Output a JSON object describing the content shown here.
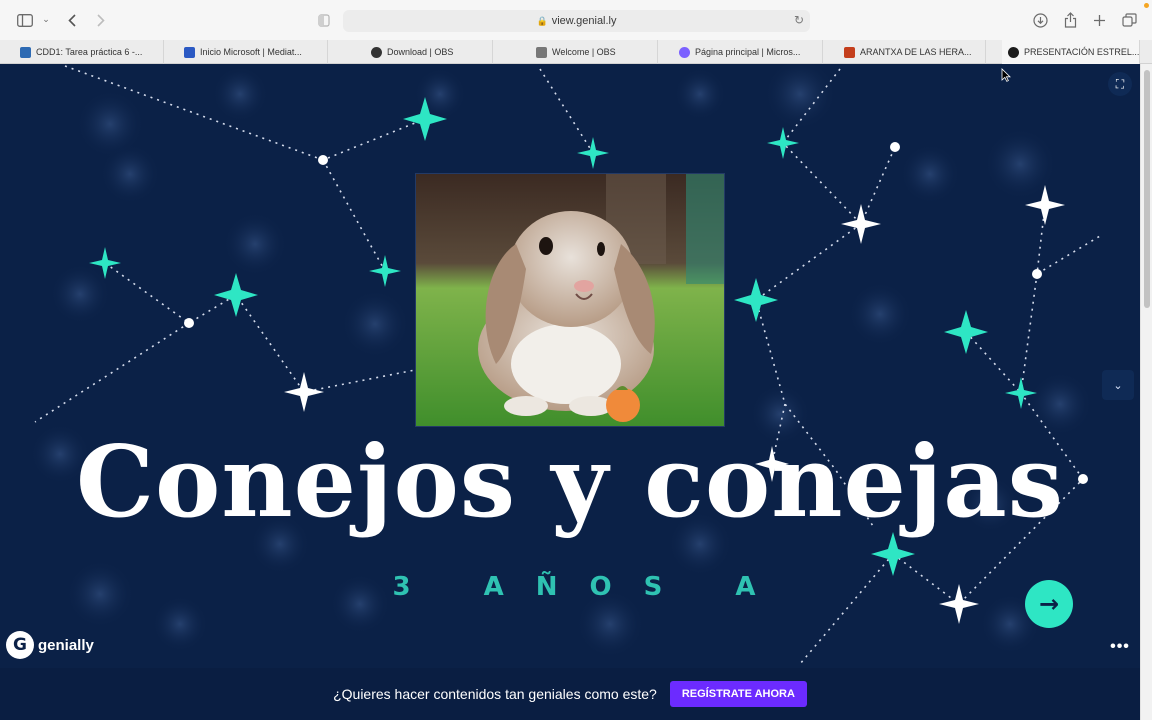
{
  "browser": {
    "url": "view.genial.ly",
    "tabs": [
      {
        "label": "CDD1: Tarea práctica 6 -...",
        "icon": "graduation-cap-icon",
        "color": "#2d6ab3"
      },
      {
        "label": "Inicio Microsoft | Mediat...",
        "icon": "clapperboard-icon",
        "color": "#2b59c3"
      },
      {
        "label": "Download | OBS",
        "icon": "obs-icon",
        "color": "#333333"
      },
      {
        "label": "Welcome | OBS",
        "icon": "obs-icon",
        "color": "#777777"
      },
      {
        "label": "Página principal | Micros...",
        "icon": "microsoft-icon",
        "color": "#7b61ff"
      },
      {
        "label": "ARANTXA DE LAS HERA...",
        "icon": "powerpoint-icon",
        "color": "#c43e1c"
      },
      {
        "label": "PRESENTACIÓN ESTREL...",
        "icon": "genially-icon",
        "color": "#1c1c1c"
      }
    ]
  },
  "presentation": {
    "title": "Conejos y conejas",
    "subtitle": "3 AÑOS A",
    "next_icon": "→",
    "more_icon": "•••",
    "side_icon": "⌄",
    "corner_icon": "⛶",
    "logo_text": "genially",
    "logo_mark": "G",
    "background": "#0b2147",
    "accent": "#2ee6c4",
    "photo_alt": "rabbit-photo"
  },
  "banner": {
    "message": "¿Quieres hacer contenidos tan geniales como este?",
    "cta": "REGÍSTRATE AHORA",
    "cta_color": "#6c2bff"
  }
}
